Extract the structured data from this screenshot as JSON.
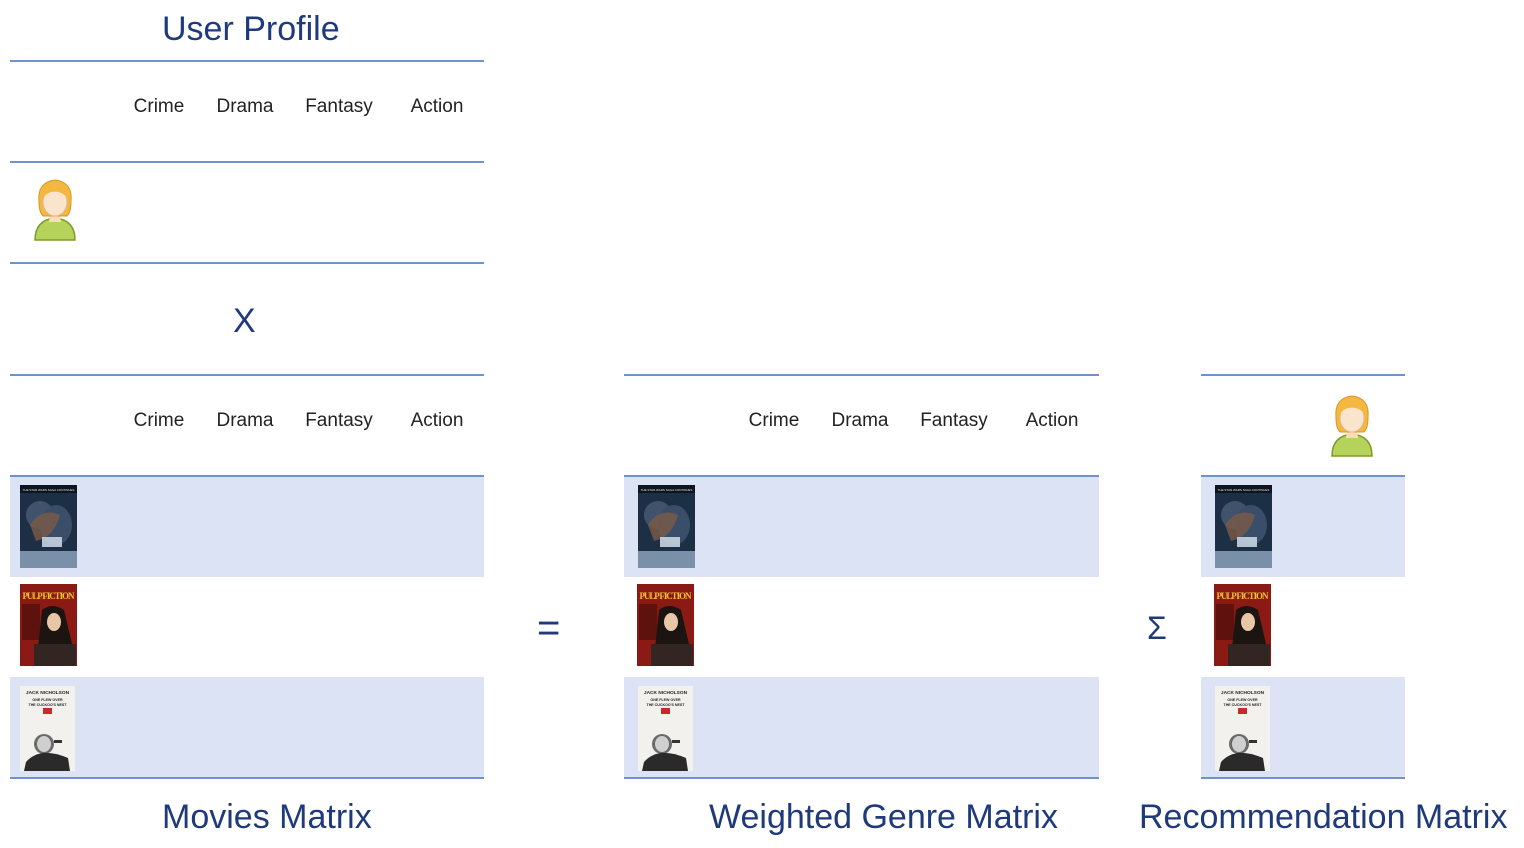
{
  "user_profile": {
    "title": "User Profile",
    "genres": [
      "Crime",
      "Drama",
      "Fantasy",
      "Action"
    ],
    "user_icon": "user-avatar-icon"
  },
  "operators": {
    "multiply": "X",
    "equals": "=",
    "sum": "Σ"
  },
  "movies_matrix": {
    "label": "Movies Matrix",
    "genres": [
      "Crime",
      "Drama",
      "Fantasy",
      "Action"
    ],
    "movies": [
      "empire-strikes-back-poster",
      "pulp-fiction-poster",
      "cuckoos-nest-poster"
    ]
  },
  "weighted_matrix": {
    "label": "Weighted Genre Matrix",
    "genres": [
      "Crime",
      "Drama",
      "Fantasy",
      "Action"
    ]
  },
  "recommendation_matrix": {
    "label": "Recommendation Matrix"
  },
  "posters": {
    "empire": {
      "text": "THE STAR WARS SAGA CONTINUES"
    },
    "pulp": {
      "text": "PULP FICTION"
    },
    "cuckoo": {
      "text1": "JACK NICHOLSON",
      "text2": "ONE FLEW OVER",
      "text3": "THE CUCKOO'S NEST"
    }
  },
  "colors": {
    "accent": "#1f3a7a",
    "line": "#6f93cf",
    "band": "#dbe3f4"
  }
}
